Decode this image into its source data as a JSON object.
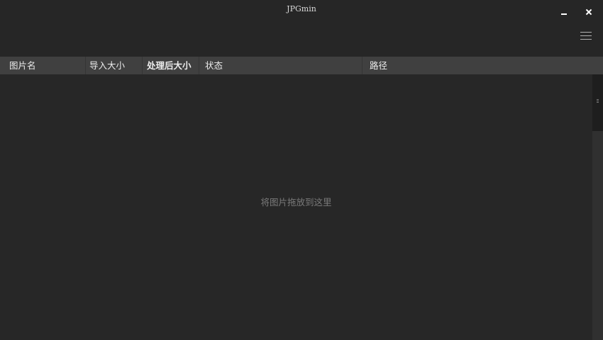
{
  "window": {
    "title": "JPGmin"
  },
  "table": {
    "columns": [
      {
        "label": "图片名"
      },
      {
        "label": "导入大小"
      },
      {
        "label": "处理后大小"
      },
      {
        "label": "状态"
      },
      {
        "label": "路径"
      }
    ],
    "rows": []
  },
  "content": {
    "drop_hint": "将图片拖放到这里"
  },
  "icons": {
    "minimize": "minimize-icon",
    "close": "close-icon",
    "menu": "hamburger-menu-icon"
  },
  "colors": {
    "background": "#272727",
    "header_bg": "#404040",
    "text": "#ececec",
    "hint_text": "#7a7a7a"
  }
}
